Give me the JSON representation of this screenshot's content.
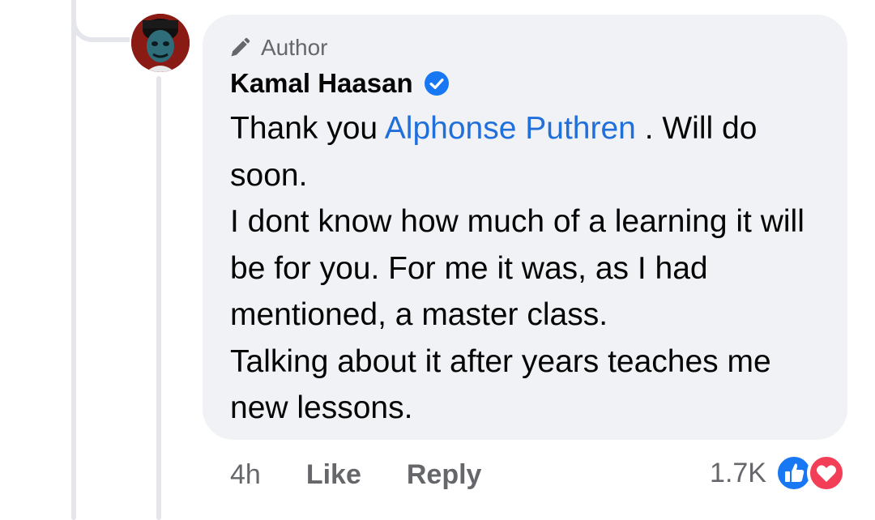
{
  "comment": {
    "badge_label": "Author",
    "author_name": "Kamal Haasan",
    "text_before_mention": "Thank you ",
    "mention": "Alphonse Puthren",
    "text_after_mention": " . Will do soon.",
    "paragraph_2": "I dont know how much of a learning it will be for you. For me it was, as I had mentioned, a master class.",
    "paragraph_3": "Talking about it after years teaches me new lessons."
  },
  "actions": {
    "time": "4h",
    "like_label": "Like",
    "reply_label": "Reply"
  },
  "reactions": {
    "count": "1.7K",
    "icons": [
      "like-reaction-icon",
      "love-reaction-icon"
    ]
  },
  "colors": {
    "bubble_bg": "#f0f2f5",
    "mention": "#216fdb",
    "verified": "#1877f2",
    "like": "#1877f2",
    "love": "#f33e58",
    "muted_text": "#65676b"
  }
}
